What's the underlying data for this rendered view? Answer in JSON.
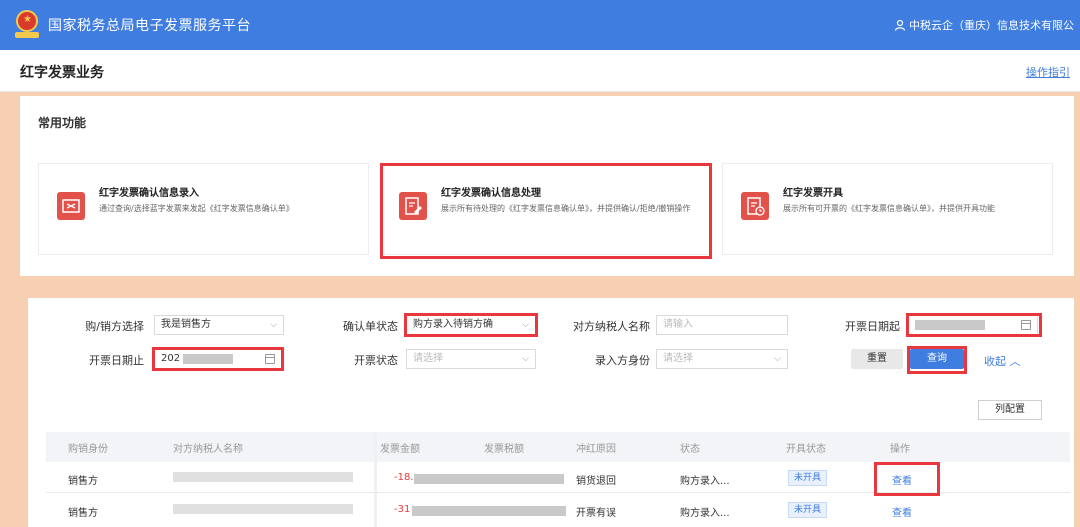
{
  "header": {
    "app_title": "国家税务总局电子发票服务平台",
    "company": "中税云企（重庆）信息技术有限公"
  },
  "page": {
    "title": "红字发票业务",
    "guide_link": "操作指引"
  },
  "common_functions": {
    "title": "常用功能",
    "items": [
      {
        "name": "红字发票确认信息录入",
        "desc": "通过查询/选择蓝字发票来发起《红字发票信息确认单》",
        "icon": "exchange-icon"
      },
      {
        "name": "红字发票确认信息处理",
        "desc": "展示所有待处理的《红字发票信息确认单》，并提供确认/拒绝/撤销操作",
        "icon": "edit-document-icon"
      },
      {
        "name": "红字发票开具",
        "desc": "展示所有可开票的《红字发票信息确认单》，并提供开具功能",
        "icon": "invoice-clock-icon"
      }
    ]
  },
  "filters": {
    "buyer_seller_label": "购/销方选择",
    "buyer_seller_value": "我是销售方",
    "confirm_status_label": "确认单状态",
    "confirm_status_value": "购方录入待销方确",
    "counterparty_label": "对方纳税人名称",
    "counterparty_placeholder": "请输入",
    "date_start_label": "开票日期起",
    "date_end_label": "开票日期止",
    "date_end_value": "202",
    "invoice_status_label": "开票状态",
    "invoice_status_placeholder": "请选择",
    "entry_identity_label": "录入方身份",
    "entry_identity_placeholder": "请选择"
  },
  "buttons": {
    "reset": "重置",
    "query": "查询",
    "collapse": "收起",
    "column_config": "列配置"
  },
  "table": {
    "headers": [
      "购销身份",
      "对方纳税人名称",
      "发票金额",
      "发票税额",
      "冲红原因",
      "状态",
      "开具状态",
      "操作"
    ],
    "rows": [
      {
        "identity": "销售方",
        "amount": "-18.",
        "reason": "销货退回",
        "status": "购方录入...",
        "issue_status": "未开具",
        "action": "查看"
      },
      {
        "identity": "销售方",
        "amount": "-31",
        "reason": "开票有误",
        "status": "购方录入...",
        "issue_status": "未开具",
        "action": "查看"
      }
    ]
  },
  "colors": {
    "brand_blue": "#3f7de0",
    "highlight_red": "#e8383d",
    "icon_red": "#e3524a",
    "background_peach": "#f7cfb3"
  }
}
